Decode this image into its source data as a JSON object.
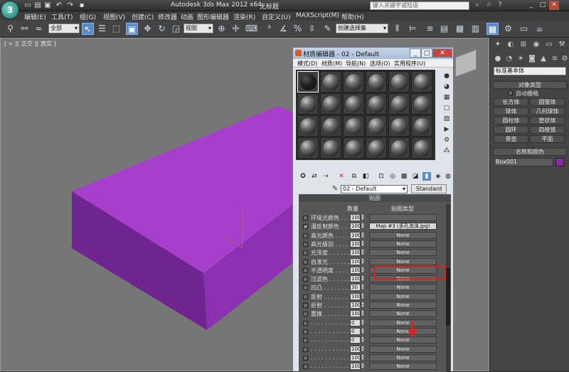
{
  "window": {
    "title": "Autodesk 3ds Max  2012 x64",
    "doc_title": "无标题",
    "search_placeholder": "键入关键字或短语",
    "min": "_",
    "max": "□",
    "close": "✕"
  },
  "menubar": {
    "items": [
      "编辑(E)",
      "工具(T)",
      "组(G)",
      "视图(V)",
      "创建(C)",
      "修改器",
      "动画",
      "图形编辑器",
      "渲染(R)",
      "自定义(U)",
      "MAXScript(M)",
      "帮助(H)"
    ]
  },
  "toolbar": {
    "filter_value": "全部",
    "view_value": "视图",
    "selset_value": "创建选择集"
  },
  "viewport": {
    "label": "[ + ][ 正交 ][ 真实 ]",
    "box_color": "#a83fd0"
  },
  "command_panel": {
    "category_value": "标准基本体",
    "object_type_title": "对象类型",
    "autogrid_label": "自动栅格",
    "object_buttons": [
      "长方体",
      "圆锥体",
      "球体",
      "几何球体",
      "圆柱体",
      "管状体",
      "圆环",
      "四棱锥",
      "茶壶",
      "平面"
    ],
    "name_color_title": "名称和颜色",
    "object_name": "Box001",
    "object_color": "#8a2aa6"
  },
  "material_editor": {
    "title": "材质编辑器 - 02 - Default",
    "min": "_",
    "max": "□",
    "close": "✕",
    "menu": [
      "模式(D)",
      "材质(M)",
      "导航(N)",
      "选项(O)",
      "实用程序(U)"
    ],
    "material_name": "02 - Default",
    "type_button": "Standard",
    "maps_rollout": "贴图",
    "col_amount": "数量",
    "col_maptype": "贴图类型",
    "map_rows": [
      {
        "checked": "",
        "label": "环境光颜色 . . .",
        "amount": "100",
        "map": ""
      },
      {
        "checked": "✓",
        "label": "漫反射颜色 . . .",
        "amount": "100",
        "map": "Map #3 (多孔泡沫.jpg)"
      },
      {
        "checked": "",
        "label": "高光颜色 . . . .",
        "amount": "100",
        "map": "None"
      },
      {
        "checked": "",
        "label": "高光级别 . . . .",
        "amount": "100",
        "map": "None"
      },
      {
        "checked": "",
        "label": "光泽度 . . . . . .",
        "amount": "100",
        "map": "None"
      },
      {
        "checked": "",
        "label": "自发光 . . . . . .",
        "amount": "100",
        "map": "None"
      },
      {
        "checked": "",
        "label": "不透明度 . . . .",
        "amount": "100",
        "map": "None"
      },
      {
        "checked": "",
        "label": "过滤色 . . . . . .",
        "amount": "100",
        "map": "None"
      },
      {
        "checked": "",
        "label": "凹凸 . . . . . . . .",
        "amount": "30",
        "map": "None"
      },
      {
        "checked": "",
        "label": "反射 . . . . . . . .",
        "amount": "100",
        "map": "None"
      },
      {
        "checked": "",
        "label": "折射 . . . . . . . .",
        "amount": "100",
        "map": "None"
      },
      {
        "checked": "",
        "label": "置换 . . . . . . . .",
        "amount": "100",
        "map": "None"
      },
      {
        "checked": "",
        "label": ". . . . . . . . . . . .",
        "amount": "0",
        "map": "None"
      },
      {
        "checked": "",
        "label": ". . . . . . . . . . . .",
        "amount": "0",
        "map": "None"
      },
      {
        "checked": "",
        "label": ". . . . . . . . . . . .",
        "amount": "0",
        "map": "None"
      },
      {
        "checked": "",
        "label": ". . . . . . . . . . . .",
        "amount": "100",
        "map": "None"
      },
      {
        "checked": "",
        "label": ". . . . . . . . . . . .",
        "amount": "100",
        "map": "None"
      },
      {
        "checked": "",
        "label": ". . . . . . . . . . . .",
        "amount": "100",
        "map": "None"
      }
    ]
  }
}
